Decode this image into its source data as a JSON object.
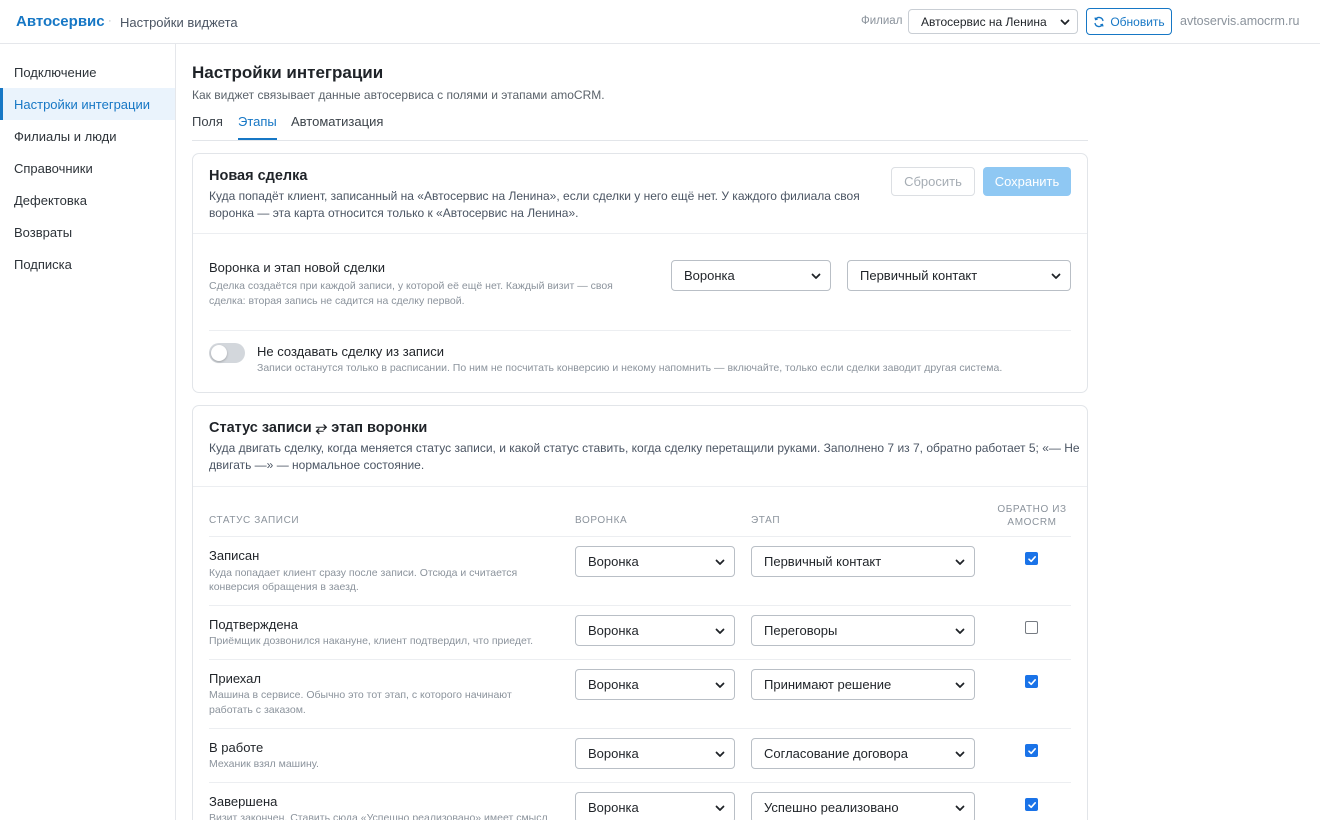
{
  "header": {
    "brand": "Автосервис",
    "separator": "·",
    "page_title": "Настройки виджета",
    "branch_label": "Филиал",
    "branch_value": "Автосервис на Ленина",
    "refresh_label": "Обновить",
    "domain": "avtoservis.amocrm.ru",
    "accent_color": "#1677c5"
  },
  "sidebar": {
    "items": [
      {
        "label": "Подключение",
        "active": false
      },
      {
        "label": "Настройки интеграции",
        "active": true
      },
      {
        "label": "Филиалы и люди",
        "active": false
      },
      {
        "label": "Справочники",
        "active": false
      },
      {
        "label": "Дефектовка",
        "active": false
      },
      {
        "label": "Возвраты",
        "active": false
      },
      {
        "label": "Подписка",
        "active": false
      }
    ]
  },
  "main": {
    "title": "Настройки интеграции",
    "subtitle": "Как виджет связывает данные автосервиса с полями и этапами amoCRM.",
    "tabs": [
      {
        "label": "Поля",
        "active": false
      },
      {
        "label": "Этапы",
        "active": true
      },
      {
        "label": "Автоматизация",
        "active": false
      }
    ]
  },
  "new_deal": {
    "title": "Новая сделка",
    "desc_line1": "Куда попадёт клиент, записанный на «Автосервис на Ленина», если сделки у него ещё нет. У каждого филиала своя",
    "desc_line2": "воронка — эта карта относится только к «Автосервис на Ленина».",
    "reset_label": "Сбросить",
    "save_label": "Сохранить",
    "funnel_label": "Воронка и этап новой сделки",
    "funnel_hint_line1": "Сделка создаётся при каждой записи, у которой её ещё нет. Каждый визит — своя",
    "funnel_hint_line2": "сделка: вторая запись не садится на сделку первой.",
    "funnel_value": "Воронка",
    "stage_value": "Первичный контакт",
    "toggle_label": "Не создавать сделку из записи",
    "toggle_hint": "Записи останутся только в расписании. По ним не посчитать конверсию и некому напомнить — включайте, только если сделки заводит другая система.",
    "toggle_on": false
  },
  "status_map": {
    "title": "Статус записи ⥂ этап воронки",
    "desc_line1": "Куда двигать сделку, когда меняется статус записи, и какой статус ставить, когда сделку перетащили руками. Заполнено 7 из 7, обратно работает 5; «— Не",
    "desc_line2": "двигать —» — нормальное состояние.",
    "col_status": "Статус записи",
    "col_funnel": "Воронка",
    "col_stage": "Этап",
    "col_back_line1": "Обратно из",
    "col_back_line2": "amoCRM",
    "rows": [
      {
        "label": "Записан",
        "hint_line1": "Куда попадает клиент сразу после записи. Отсюда и считается",
        "hint_line2": "конверсия обращения в заезд.",
        "funnel": "Воронка",
        "stage": "Первичный контакт",
        "back": true
      },
      {
        "label": "Подтверждена",
        "hint_line1": "Приёмщик дозвонился накануне, клиент подтвердил, что приедет.",
        "hint_line2": "",
        "funnel": "Воронка",
        "stage": "Переговоры",
        "back": false
      },
      {
        "label": "Приехал",
        "hint_line1": "Машина в сервисе. Обычно это тот этап, с которого начинают",
        "hint_line2": "работать с заказом.",
        "funnel": "Воронка",
        "stage": "Принимают решение",
        "back": true
      },
      {
        "label": "В работе",
        "hint_line1": "Механик взял машину.",
        "hint_line2": "",
        "funnel": "Воронка",
        "stage": "Согласование договора",
        "back": true
      },
      {
        "label": "Завершена",
        "hint_line1": "Визит закончен. Ставить сюда «Успешно реализовано» имеет смысл",
        "hint_line2": "",
        "funnel": "Воронка",
        "stage": "Успешно реализовано",
        "back": true
      }
    ]
  }
}
